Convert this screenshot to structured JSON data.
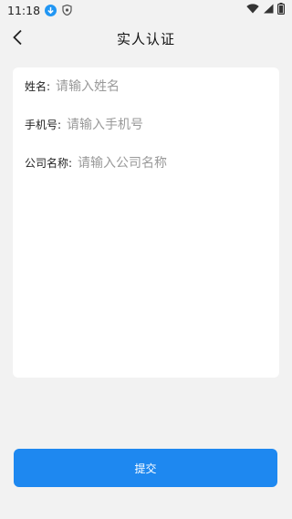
{
  "status_bar": {
    "time": "11:18",
    "icons": [
      "download-icon",
      "shield-icon",
      "wifi-icon",
      "signal-icon",
      "battery-icon"
    ]
  },
  "header": {
    "title": "实人认证",
    "back_icon": "chevron-left-icon"
  },
  "form": {
    "fields": [
      {
        "label": "姓名:",
        "placeholder": "请输入姓名",
        "value": ""
      },
      {
        "label": "手机号:",
        "placeholder": "请输入手机号",
        "value": ""
      },
      {
        "label": "公司名称:",
        "placeholder": "请输入公司名称",
        "value": ""
      }
    ]
  },
  "submit": {
    "label": "提交"
  },
  "colors": {
    "accent": "#1e88f0",
    "background": "#f2f2f2",
    "card": "#ffffff"
  }
}
